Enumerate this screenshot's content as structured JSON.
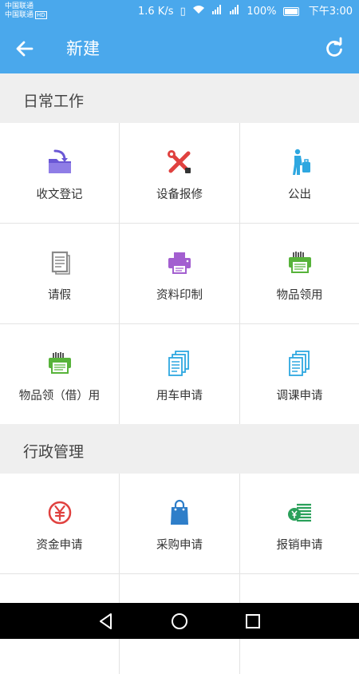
{
  "status_bar": {
    "carrier1": "中国联通",
    "carrier2": "中国联通",
    "hd_badge": "HD",
    "speed": "1.6 K/s",
    "battery": "100%",
    "time": "下午3:00"
  },
  "header": {
    "title": "新建",
    "back_icon": "arrow-left-icon",
    "refresh_icon": "refresh-icon"
  },
  "sections": [
    {
      "title": "日常工作",
      "items": [
        {
          "label": "收文登记",
          "icon": "folder-receive-icon",
          "color": "#6a57d5"
        },
        {
          "label": "设备报修",
          "icon": "tools-icon",
          "color": "#e0413f"
        },
        {
          "label": "公出",
          "icon": "business-trip-icon",
          "color": "#2ea7e0"
        },
        {
          "label": "请假",
          "icon": "document-icon",
          "color": "#8a8a8a"
        },
        {
          "label": "资料印制",
          "icon": "printer-icon",
          "color": "#a35fd0"
        },
        {
          "label": "物品领用",
          "icon": "supplies-icon",
          "color": "#57b33a"
        },
        {
          "label": "物品领（借）用",
          "icon": "supplies-borrow-icon",
          "color": "#57b33a"
        },
        {
          "label": "用车申请",
          "icon": "car-request-icon",
          "color": "#2ea7e0"
        },
        {
          "label": "调课申请",
          "icon": "class-change-icon",
          "color": "#2ea7e0"
        }
      ]
    },
    {
      "title": "行政管理",
      "items": [
        {
          "label": "资金申请",
          "icon": "yuan-icon",
          "color": "#e0413f"
        },
        {
          "label": "采购申请",
          "icon": "shopping-bag-icon",
          "color": "#2e7ec9"
        },
        {
          "label": "报销申请",
          "icon": "reimbursement-icon",
          "color": "#2aa05a"
        }
      ]
    }
  ]
}
